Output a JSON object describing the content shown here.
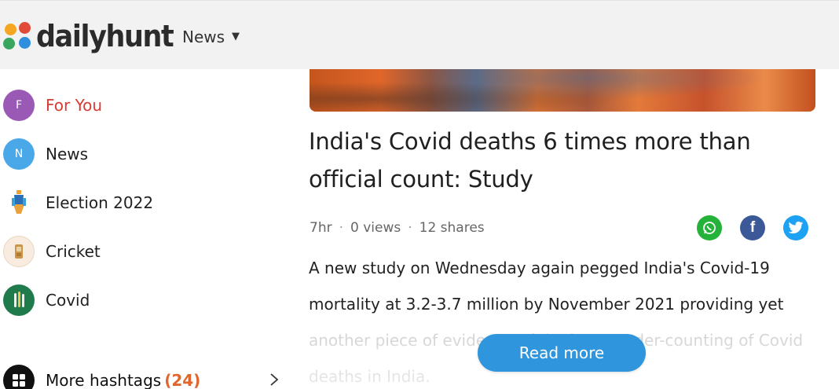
{
  "header": {
    "logo_text": "dailyhunt",
    "logo_dot_colors": [
      "#f5a623",
      "#e04b3a",
      "#3aa55d",
      "#2f8fdd"
    ],
    "nav_label": "News",
    "nav_caret": "▼"
  },
  "sidebar": {
    "items": [
      {
        "label": "For You",
        "avatar_letter": "F",
        "avatar_color": "#9b59b6",
        "active": true
      },
      {
        "label": "News",
        "avatar_letter": "N",
        "avatar_color": "#4aa8e8",
        "active": false
      },
      {
        "label": "Election 2022",
        "icon": "election-icon",
        "active": false
      },
      {
        "label": "Cricket",
        "icon": "cricket-icon",
        "active": false
      },
      {
        "label": "Covid",
        "icon": "covid-icon",
        "active": false
      }
    ],
    "more_hashtags": {
      "label": "More hashtags",
      "count": "(24)"
    }
  },
  "article": {
    "headline": "India's Covid deaths 6 times more than official count: Study",
    "time": "7hr",
    "views": "0 views",
    "shares": "12 shares",
    "separator": "·",
    "body": "A new study on Wednesday again pegged India's Covid-19 mortality at 3.2-3.7 million by November 2021 providing yet another piece of evidence of the huge under-counting of Covid deaths in India.",
    "read_more": "Read more",
    "share_icons": [
      "whatsapp-icon",
      "facebook-icon",
      "twitter-icon"
    ],
    "facebook_glyph": "f"
  },
  "colors": {
    "accent_red": "#d93a33",
    "read_more_blue": "#2f95dd",
    "hashtag_count": "#e0662e"
  }
}
